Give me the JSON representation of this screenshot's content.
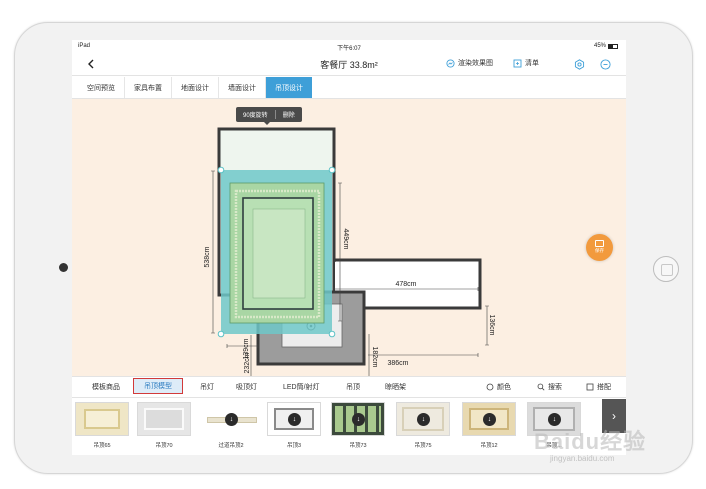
{
  "status": {
    "carrier": "iPad",
    "time": "下午6:07",
    "battery": "45%"
  },
  "header": {
    "title": "客餐厅 33.8m²",
    "render_label": "渲染效果图",
    "list_label": "清单"
  },
  "tabs": [
    {
      "label": "空间预览"
    },
    {
      "label": "家具布置"
    },
    {
      "label": "地面设计"
    },
    {
      "label": "墙面设计"
    },
    {
      "label": "吊顶设计"
    }
  ],
  "canvas": {
    "popup": {
      "rotate_label": "90度旋转",
      "delete_label": "删除"
    },
    "dimensions": {
      "left": "538cm",
      "inner": "449cm",
      "corridor_top": "478cm",
      "corridor_right": "136cm",
      "lower_left": "139cm",
      "lower_vertical": "232cm",
      "lower_right": "182cm",
      "corridor_bottom": "386cm"
    },
    "save_label": "保存"
  },
  "categories": {
    "items": [
      {
        "label": "模板商品"
      },
      {
        "label": "吊顶模型"
      },
      {
        "label": "吊灯"
      },
      {
        "label": "吸顶灯"
      },
      {
        "label": "LED筒/射灯"
      },
      {
        "label": "吊顶"
      },
      {
        "label": "晾晒架"
      }
    ],
    "color_label": "颜色",
    "search_label": "搜索",
    "match_label": "搭配"
  },
  "products": [
    {
      "label": "吊顶65"
    },
    {
      "label": "吊顶70"
    },
    {
      "label": "过道吊顶2"
    },
    {
      "label": "吊顶3"
    },
    {
      "label": "吊顶73"
    },
    {
      "label": "吊顶75"
    },
    {
      "label": "吊顶12"
    },
    {
      "label": "吊顶..."
    }
  ],
  "watermark": {
    "brand": "Baidu经验",
    "url": "jingyan.baidu.com"
  },
  "colors": {
    "accent": "#3e9fd8",
    "selection": "#5cc2c6",
    "canvas_bg": "#fcefe2",
    "fab": "#f29a3d",
    "highlight_border": "#d23a3a"
  }
}
